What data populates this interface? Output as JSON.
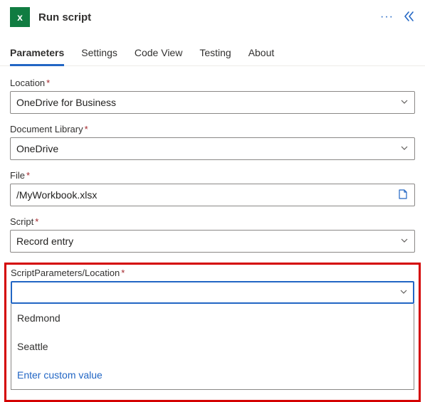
{
  "header": {
    "title": "Run script",
    "app_icon_text": "x"
  },
  "tabs": [
    {
      "label": "Parameters",
      "active": true
    },
    {
      "label": "Settings",
      "active": false
    },
    {
      "label": "Code View",
      "active": false
    },
    {
      "label": "Testing",
      "active": false
    },
    {
      "label": "About",
      "active": false
    }
  ],
  "fields": {
    "location": {
      "label": "Location",
      "value": "OneDrive for Business",
      "required": true
    },
    "docLibrary": {
      "label": "Document Library",
      "value": "OneDrive",
      "required": true
    },
    "file": {
      "label": "File",
      "value": "/MyWorkbook.xlsx",
      "required": true
    },
    "script": {
      "label": "Script",
      "value": "Record entry",
      "required": true
    },
    "spLocation": {
      "label": "ScriptParameters/Location",
      "value": "",
      "required": true
    }
  },
  "dropdown": {
    "options": [
      "Redmond",
      "Seattle"
    ],
    "custom_label": "Enter custom value"
  }
}
